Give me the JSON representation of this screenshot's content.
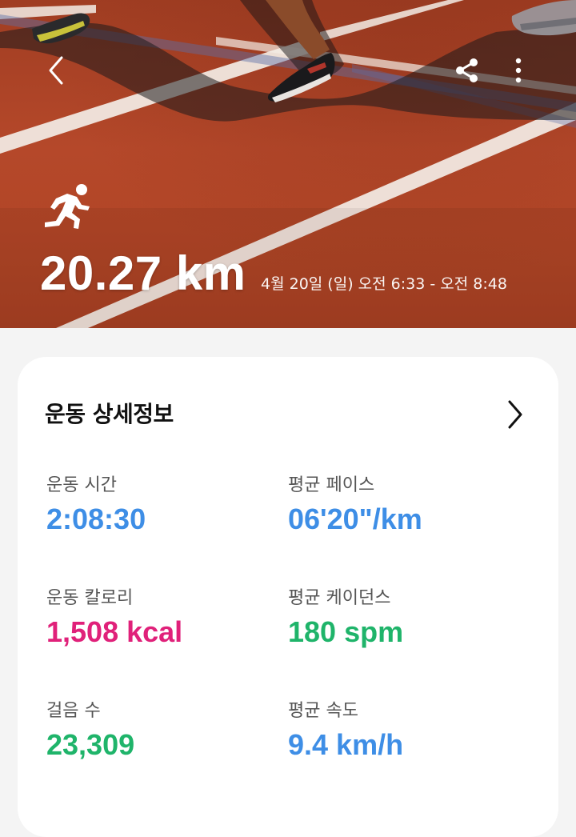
{
  "header": {
    "distance": "20.27 km",
    "datetime": "4월 20일 (일) 오전 6:33 - 오전 8:48",
    "icons": [
      "back-icon",
      "share-icon",
      "more-vert-icon",
      "running-icon"
    ]
  },
  "details": {
    "title": "운동 상세정보",
    "stats": [
      {
        "label": "운동 시간",
        "value": "2:08:30",
        "color": "#3e8ee6"
      },
      {
        "label": "평균 페이스",
        "value": "06'20\"/km",
        "color": "#3e8ee6"
      },
      {
        "label": "운동 칼로리",
        "value": "1,508 kcal",
        "color": "#e0217a"
      },
      {
        "label": "평균 케이던스",
        "value": "180 spm",
        "color": "#1fb46a"
      },
      {
        "label": "걸음 수",
        "value": "23,309",
        "color": "#1fb46a"
      },
      {
        "label": "평균 속도",
        "value": "9.4 km/h",
        "color": "#3e8ee6"
      }
    ]
  },
  "theme": {
    "track_color": "#b5482a",
    "card_bg": "#ffffff",
    "page_bg": "#f4f4f4"
  }
}
